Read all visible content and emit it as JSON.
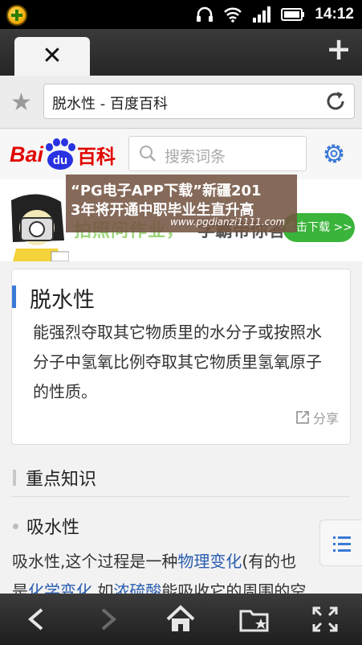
{
  "status_bar": {
    "time": "14:12"
  },
  "browser": {
    "url_text": "脱水性 - 百度百科"
  },
  "baidu_header": {
    "logo_bai": "Bai",
    "logo_du": "du",
    "logo_baike": "百科",
    "search_placeholder": "搜索词条"
  },
  "banner": {
    "slogan": "拍照问作业，",
    "slogan_tail": "学霸带你答",
    "download_label": "点击下载 >>",
    "overlay_line1": "“PG电子APP下载”新疆201",
    "overlay_line2": "3年将开通中职毕业生直升高",
    "overlay_line3": "www.pgdianzi1111.com"
  },
  "definition": {
    "title": "脱水性",
    "text": "能强烈夺取其它物质里的水分子或按照水分子中氢氧比例夺取其它物质里氢氧原子的性质。",
    "share_label": "分享"
  },
  "content": {
    "section_title": "重点知识",
    "subsection_title": "吸水性",
    "para_t1": "吸水性,这个过程是一种",
    "para_link1": "物理变化",
    "para_t2": "(有的也",
    "para_t3": "是",
    "para_link2": "化学变化",
    "para_t4": ",如",
    "para_link3": "浓硫酸",
    "para_t5": "能吸收它的周围的空"
  },
  "colors": {
    "accent_blue": "#3b79d6",
    "baidu_red": "#e10601",
    "baidu_blue": "#2932e1",
    "link": "#2a5db0",
    "download_green": "#3ab43a"
  }
}
